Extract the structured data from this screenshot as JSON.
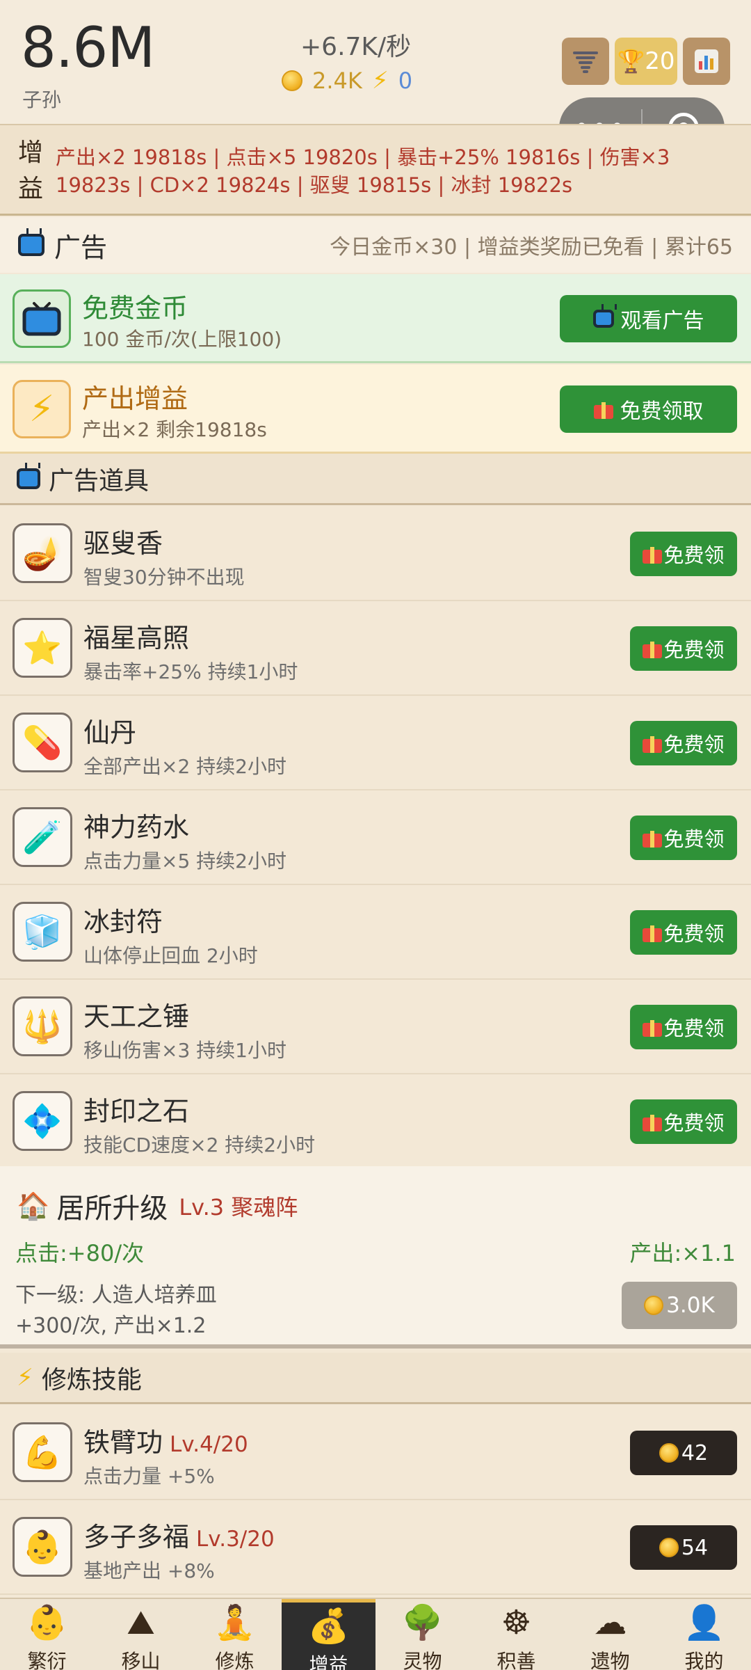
{
  "header": {
    "count": "8.6M",
    "count_label": "子孙",
    "rate": "+6.7K/秒",
    "coins": "2.4K",
    "energy": "0",
    "trophy_count": "20"
  },
  "buffs": {
    "title": "增益",
    "text": "产出×2 19818s | 点击×5 19820s | 暴击+25% 19816s | 伤害×3 19823s | CD×2 19824s | 驱叟 19815s | 冰封 19822s"
  },
  "ads": {
    "title": "广告",
    "info": "今日金币×30 | 增益类奖励已免看 | 累计65",
    "free_coins": {
      "name": "免费金币",
      "desc": "100 金币/次(上限100)",
      "button": "观看广告"
    },
    "output_buff": {
      "name": "产出增益",
      "desc": "产出×2 剩余19818s",
      "button": "免费领取"
    }
  },
  "ad_items": {
    "title": "广告道具",
    "button": "免费领",
    "items": [
      {
        "name": "驱叟香",
        "desc": "智叟30分钟不出现",
        "icon": "incense-icon"
      },
      {
        "name": "福星高照",
        "desc": "暴击率+25% 持续1小时",
        "icon": "star-icon"
      },
      {
        "name": "仙丹",
        "desc": "全部产出×2 持续2小时",
        "icon": "pill-icon"
      },
      {
        "name": "神力药水",
        "desc": "点击力量×5 持续2小时",
        "icon": "potion-icon"
      },
      {
        "name": "冰封符",
        "desc": "山体停止回血 2小时",
        "icon": "ice-cube-icon"
      },
      {
        "name": "天工之锤",
        "desc": "移山伤害×3 持续1小时",
        "icon": "hammer-icon"
      },
      {
        "name": "封印之石",
        "desc": "技能CD速度×2 持续2小时",
        "icon": "seal-stone-icon"
      }
    ]
  },
  "residence": {
    "title": "居所升级",
    "level": "Lv.3 聚魂阵",
    "click": "点击:+80/次",
    "output": "产出:×1.1",
    "next": "下一级: 人造人培养皿",
    "next_detail": "+300/次, 产出×1.2",
    "cost": "3.0K"
  },
  "skills": {
    "title": "修炼技能",
    "items": [
      {
        "name": "铁臂功",
        "level": "Lv.4/20",
        "desc": "点击力量 +5%",
        "cost": "42"
      },
      {
        "name": "多子多福",
        "level": "Lv.3/20",
        "desc": "基地产出 +8%",
        "cost": "54"
      }
    ]
  },
  "nav": [
    {
      "label": "繁衍",
      "icon": "baby-icon"
    },
    {
      "label": "移山",
      "icon": "mountain-icon"
    },
    {
      "label": "修炼",
      "icon": "meditation-icon"
    },
    {
      "label": "增益",
      "icon": "money-bag-icon"
    },
    {
      "label": "灵物",
      "icon": "tree-icon"
    },
    {
      "label": "积善",
      "icon": "dharma-wheel-icon"
    },
    {
      "label": "遗物",
      "icon": "cloud-icon"
    },
    {
      "label": "我的",
      "icon": "user-icon"
    }
  ],
  "colors": {
    "accent_green": "#2f9238",
    "buff_red": "#b23a2c",
    "background": "#f3e8d6"
  }
}
